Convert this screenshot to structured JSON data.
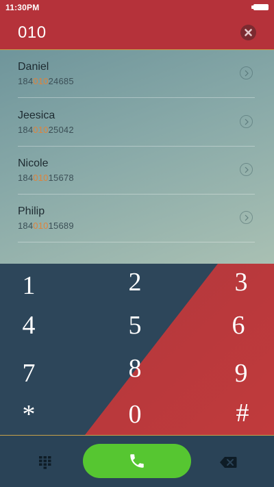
{
  "status_bar": {
    "time": "11:30PM"
  },
  "search": {
    "query": "010"
  },
  "contacts": [
    {
      "name": "Daniel",
      "number_prefix": "184",
      "number_match": "010",
      "number_suffix": "24685"
    },
    {
      "name": "Jeesica",
      "number_prefix": "184",
      "number_match": "010",
      "number_suffix": "25042"
    },
    {
      "name": "Nicole",
      "number_prefix": "184",
      "number_match": "010",
      "number_suffix": "15678"
    },
    {
      "name": "Philip",
      "number_prefix": "184",
      "number_match": "010",
      "number_suffix": "15689"
    }
  ],
  "keypad": {
    "keys": [
      "1",
      "2",
      "3",
      "4",
      "5",
      "6",
      "7",
      "8",
      "9",
      "*",
      "0",
      "#"
    ]
  },
  "icons": {
    "clear": "close-icon",
    "detail": "chevron-right-icon",
    "dialpad": "dialpad-icon",
    "call": "phone-icon",
    "backspace": "backspace-icon"
  },
  "colors": {
    "header": "#b5323a",
    "accent_divider": "#c8a24a",
    "match_highlight": "#e0833a",
    "call_button": "#56c631",
    "keypad_dark": "#2d465a",
    "keypad_red": "#b5323a"
  }
}
